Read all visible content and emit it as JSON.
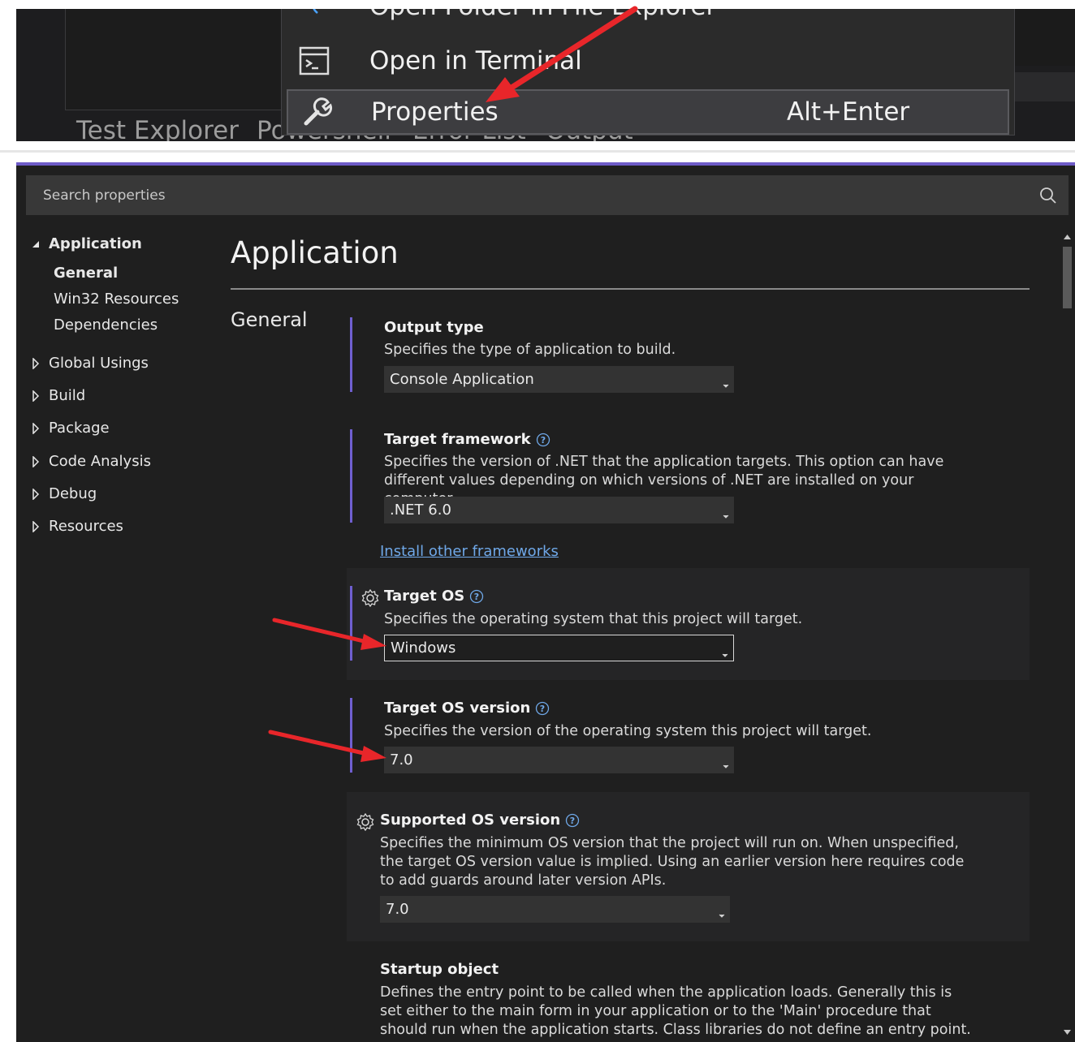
{
  "context_menu": {
    "cut_off_item": "Open Folder in File Explorer",
    "terminal_label": "Open in Terminal",
    "properties_label": "Properties",
    "properties_shortcut": "Alt+Enter",
    "tabs": [
      "Test Explorer",
      "Powershell",
      "Error List",
      "Output"
    ]
  },
  "search": {
    "placeholder": "Search properties"
  },
  "nav": {
    "application": "Application",
    "sub": [
      "General",
      "Win32 Resources",
      "Dependencies"
    ],
    "groups": [
      "Global Usings",
      "Build",
      "Package",
      "Code Analysis",
      "Debug",
      "Resources"
    ]
  },
  "page": {
    "title": "Application",
    "section": "General"
  },
  "props": {
    "output_type": {
      "name": "Output type",
      "desc": "Specifies the type of application to build.",
      "value": "Console Application"
    },
    "target_framework": {
      "name": "Target framework",
      "desc": "Specifies the version of .NET that the application targets. This option can have different values depending on which versions of .NET are installed on your computer.",
      "value": ".NET 6.0",
      "link": "Install other frameworks"
    },
    "target_os": {
      "name": "Target OS",
      "desc": "Specifies the operating system that this project will target.",
      "value": "Windows"
    },
    "target_os_version": {
      "name": "Target OS version",
      "desc": "Specifies the version of the operating system this project will target.",
      "value": "7.0"
    },
    "supported_os_version": {
      "name": "Supported OS version",
      "desc": "Specifies the minimum OS version that the project will run on. When unspecified, the target OS version value is implied. Using an earlier version here requires code to add guards around later version APIs.",
      "value": "7.0"
    },
    "startup_object": {
      "name": "Startup object",
      "desc": "Defines the entry point to be called when the application loads. Generally this is set either to the main form in your application or to the 'Main' procedure that should run when the application starts. Class libraries do not define an entry point."
    }
  },
  "colors": {
    "accent": "#6f5fd0",
    "arrow": "#e8262a",
    "link": "#6fa8e8",
    "panel_bg": "#1f1f1f"
  }
}
